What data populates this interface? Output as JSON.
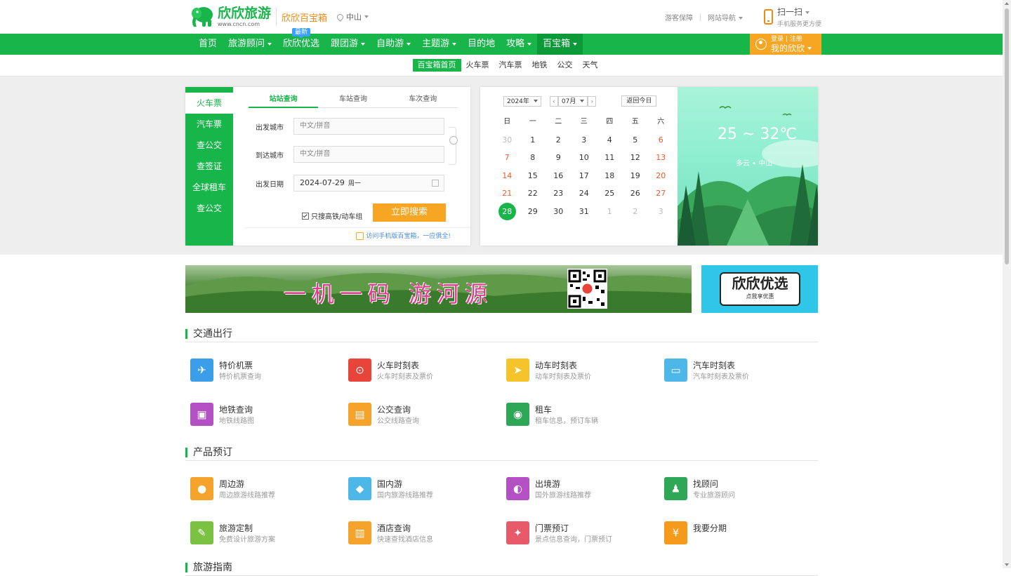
{
  "header": {
    "logo_cn": "欣欣旅游",
    "logo_url": "www.cncn.com",
    "subtitle": "欣欣百宝箱",
    "city": "中山",
    "links": [
      "游客保障",
      "网站导航"
    ],
    "scan_title": "扫一扫",
    "scan_sub": "手机服务更方便",
    "accent": "#18b64a",
    "orange": "#f6a623"
  },
  "nav": {
    "items": [
      {
        "label": "首页",
        "dropdown": false
      },
      {
        "label": "旅游顾问",
        "dropdown": true
      },
      {
        "label": "欣欣优选",
        "dropdown": false,
        "badge": "最新"
      },
      {
        "label": "跟团游",
        "dropdown": true
      },
      {
        "label": "自助游",
        "dropdown": true
      },
      {
        "label": "主题游",
        "dropdown": true
      },
      {
        "label": "目的地",
        "dropdown": false
      },
      {
        "label": "攻略",
        "dropdown": true
      },
      {
        "label": "百宝箱",
        "dropdown": true,
        "active": true
      }
    ],
    "login_top": "登录 | 注册",
    "login_bottom": "我的欣欣"
  },
  "subnav": [
    "百宝箱首页",
    "火车票",
    "汽车票",
    "地铁",
    "公交",
    "天气"
  ],
  "search": {
    "side_tabs": [
      "火车票",
      "汽车票",
      "查公交",
      "查签证",
      "全球租车",
      "查公交"
    ],
    "tabs": [
      "站站查询",
      "车站查询",
      "车次查询"
    ],
    "from_label": "出发城市",
    "to_label": "到达城市",
    "date_label": "出发日期",
    "placeholder": "中文/拼音",
    "date_value": "2024-07-29",
    "weekday": "周一",
    "checkbox_label": "只搜高铁/动车组",
    "button": "立即搜索",
    "tip": "访问手机版百宝箱，一应俱全!"
  },
  "calendar": {
    "year": "2024年",
    "month": "07月",
    "today_btn": "返回今日",
    "weekdays": [
      "日",
      "一",
      "二",
      "三",
      "四",
      "五",
      "六"
    ],
    "weeks": [
      [
        "30",
        "1",
        "2",
        "3",
        "4",
        "5",
        "6"
      ],
      [
        "7",
        "8",
        "9",
        "10",
        "11",
        "12",
        "13"
      ],
      [
        "14",
        "15",
        "16",
        "17",
        "18",
        "19",
        "20"
      ],
      [
        "21",
        "22",
        "23",
        "24",
        "25",
        "26",
        "27"
      ],
      [
        "28",
        "29",
        "30",
        "31",
        "1",
        "2",
        "3"
      ]
    ],
    "today": "28"
  },
  "weather": {
    "temp": "25 ~ 32℃",
    "cond": "多云 • 中山"
  },
  "banners": {
    "main_slogan": "一机一码 游河源",
    "side_title": "欣欣优选",
    "side_sub": "点我享优惠"
  },
  "sections": [
    {
      "title": "交通出行",
      "items": [
        {
          "title": "特价机票",
          "desc": "特价机票查询",
          "icon": "plane-icon",
          "color": "#3a9ee8",
          "glyph": "✈"
        },
        {
          "title": "火车时刻表",
          "desc": "火车时刻表及票价",
          "icon": "train-icon",
          "color": "#e8453a",
          "glyph": "⊙"
        },
        {
          "title": "动车时刻表",
          "desc": "动车时刻表及票价",
          "icon": "bullet-train-icon",
          "color": "#f4c42a",
          "glyph": "➤"
        },
        {
          "title": "汽车时刻表",
          "desc": "汽车时刻表及票价",
          "icon": "bus-icon",
          "color": "#4db8e8",
          "glyph": "▭"
        },
        {
          "title": "地铁查询",
          "desc": "地铁线路图",
          "icon": "subway-icon",
          "color": "#b350c3",
          "glyph": "▣"
        },
        {
          "title": "公交查询",
          "desc": "公交线路查询",
          "icon": "city-bus-icon",
          "color": "#f5a32a",
          "glyph": "▤"
        },
        {
          "title": "租车",
          "desc": "租车信息，预订车辆",
          "icon": "car-icon",
          "color": "#2ea856",
          "glyph": "◉"
        }
      ]
    },
    {
      "title": "产品预订",
      "items": [
        {
          "title": "周边游",
          "desc": "周边旅游线路推荐",
          "icon": "location-icon",
          "color": "#f5a32a",
          "glyph": "●"
        },
        {
          "title": "国内游",
          "desc": "国内旅游线路推荐",
          "icon": "china-map-icon",
          "color": "#4db8e8",
          "glyph": "◆"
        },
        {
          "title": "出境游",
          "desc": "国外旅游线路推荐",
          "icon": "globe-icon",
          "color": "#b350c3",
          "glyph": "◐"
        },
        {
          "title": "找顾问",
          "desc": "专业旅游顾问",
          "icon": "advisor-icon",
          "color": "#2ea856",
          "glyph": "♟"
        },
        {
          "title": "旅游定制",
          "desc": "免费设计旅游方案",
          "icon": "custom-tour-icon",
          "color": "#7bc142",
          "glyph": "✎"
        },
        {
          "title": "酒店查询",
          "desc": "快速查找酒店信息",
          "icon": "hotel-icon",
          "color": "#f5a32a",
          "glyph": "▥"
        },
        {
          "title": "门票预订",
          "desc": "景点信息查询，门票预订",
          "icon": "ticket-icon",
          "color": "#e8596a",
          "glyph": "✦"
        },
        {
          "title": "我要分期",
          "desc": "",
          "icon": "installment-icon",
          "color": "#f59a1a",
          "glyph": "¥"
        }
      ]
    },
    {
      "title": "旅游指南",
      "items": []
    }
  ]
}
